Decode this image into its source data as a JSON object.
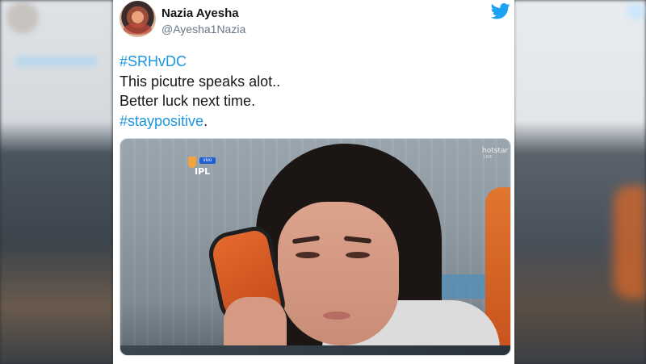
{
  "tweet": {
    "display_name": "Nazia Ayesha",
    "handle": "@Ayesha1Nazia",
    "lines": [
      {
        "text": "#SRHvDC",
        "type": "hashtag"
      },
      {
        "text": "This picutre speaks alot..",
        "type": "text"
      },
      {
        "text": "Better luck next time.",
        "type": "text"
      }
    ],
    "last_hashtag": "#staypositive",
    "last_punct": ".",
    "icons": {
      "bird": "twitter-bird-icon",
      "avatar": "user-avatar"
    },
    "colors": {
      "link": "#1b95e0",
      "brand": "#1da1f2",
      "text": "#14171a",
      "muted": "#657786"
    }
  },
  "media": {
    "overlay_logo": "IPL",
    "overlay_logo_badge": "vivo",
    "broadcaster": "hotstar",
    "broadcaster_sub": "LIVE"
  }
}
